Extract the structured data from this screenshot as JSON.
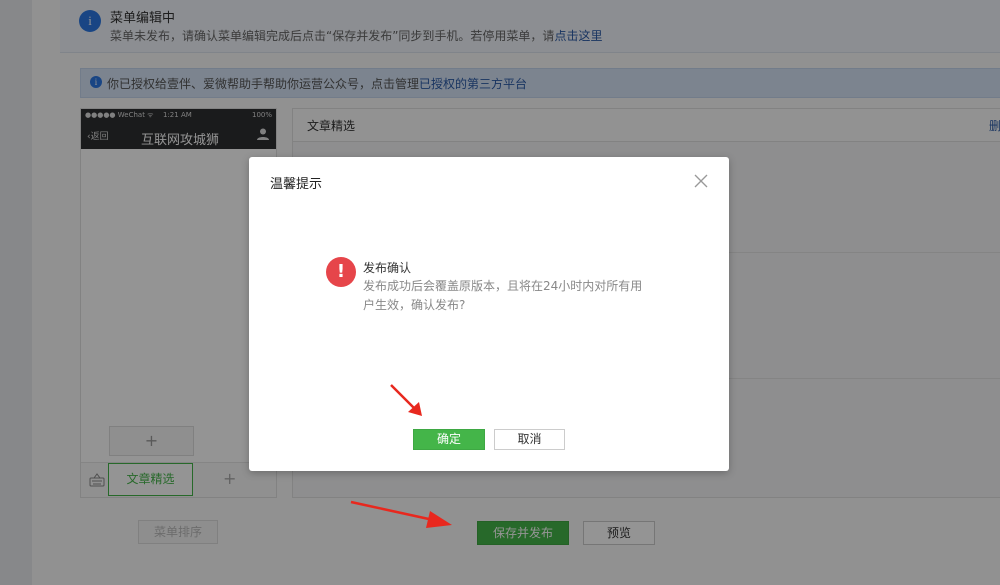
{
  "notice": {
    "title": "菜单编辑中",
    "text_prefix": "菜单未发布，请确认菜单编辑完成后点击“保存并发布”同步到手机。若停用菜单，请",
    "link": "点击这里"
  },
  "auth_bar": {
    "text_prefix": "你已授权给壹伴、爱微帮助手帮助你运营公众号，点击管理",
    "link": "已授权的第三方平台"
  },
  "phone": {
    "carrier": "●●●●● WeChat ᯤ",
    "time": "1:21 AM",
    "battery": "100%",
    "back": "返回",
    "title": "互联网攻城狮",
    "add_symbol": "+",
    "menu_tab": "文章精选",
    "add_menu_symbol": "+"
  },
  "editor": {
    "menu_name": "文章精选",
    "delete": "删"
  },
  "buttons": {
    "sort": "菜单排序",
    "save_publish": "保存并发布",
    "preview": "预览"
  },
  "dialog": {
    "title": "温馨提示",
    "message_title": "发布确认",
    "message_body": "发布成功后会覆盖原版本，且将在24小时内对所有用户生效，确认发布?",
    "ok": "确定",
    "cancel": "取消"
  },
  "colors": {
    "accent_green": "#44b549",
    "warning_red": "#e6454a",
    "link_blue": "#2b5ba7",
    "arrow_red": "#e8281e"
  },
  "icons": {
    "notice": "info-icon",
    "auth": "info-icon",
    "user": "user-icon",
    "keyboard": "keyboard-icon",
    "close": "close-icon",
    "warning": "exclamation-icon",
    "arrow": "red-arrow-icon"
  }
}
